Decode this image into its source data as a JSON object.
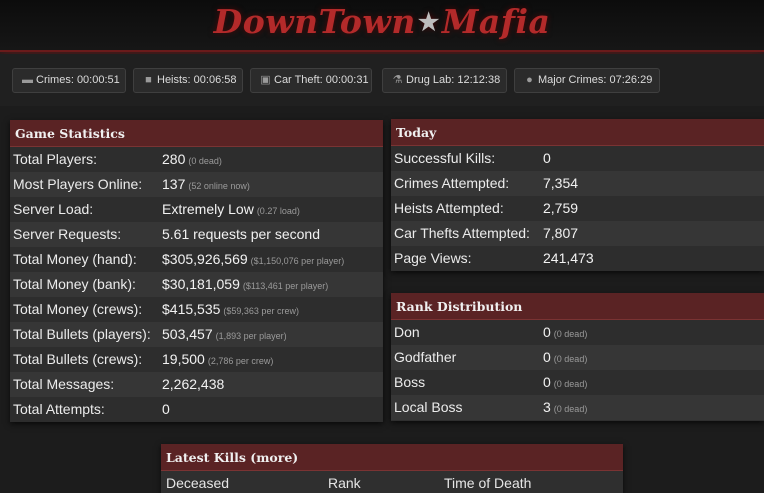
{
  "header": {
    "logo_left": "DownTown",
    "logo_star": "★",
    "logo_right": "Mafia"
  },
  "timers": [
    {
      "icon": "gun-icon",
      "label": "Crimes: 00:00:51"
    },
    {
      "icon": "truck-icon",
      "label": "Heists: 00:06:58"
    },
    {
      "icon": "car-icon",
      "label": "Car Theft: 00:00:31"
    },
    {
      "icon": "flask-icon",
      "label": "Drug Lab: 12:12:38"
    },
    {
      "icon": "group-icon",
      "label": "Major Crimes: 07:26:29"
    }
  ],
  "game_stats": {
    "title": "Game Statistics",
    "rows": [
      {
        "label": "Total Players:",
        "value": "280",
        "sub": "(0 dead)"
      },
      {
        "label": "Most Players Online:",
        "value": "137",
        "sub": "(52 online now)"
      },
      {
        "label": "Server Load:",
        "value": "Extremely Low",
        "sub": "(0.27 load)"
      },
      {
        "label": "Server Requests:",
        "value": "5.61 requests per second",
        "sub": ""
      },
      {
        "label": "Total Money (hand):",
        "value": "$305,926,569",
        "sub": "($1,150,076 per player)"
      },
      {
        "label": "Total Money (bank):",
        "value": "$30,181,059",
        "sub": "($113,461 per player)"
      },
      {
        "label": "Total Money (crews):",
        "value": "$415,535",
        "sub": "($59,363 per crew)"
      },
      {
        "label": "Total Bullets (players):",
        "value": "503,457",
        "sub": "(1,893 per player)"
      },
      {
        "label": "Total Bullets (crews):",
        "value": "19,500",
        "sub": "(2,786 per crew)"
      },
      {
        "label": "Total Messages:",
        "value": "2,262,438",
        "sub": ""
      },
      {
        "label": "Total Attempts:",
        "value": "0",
        "sub": ""
      }
    ]
  },
  "today": {
    "title": "Today",
    "rows": [
      {
        "label": "Successful Kills:",
        "value": "0"
      },
      {
        "label": "Crimes Attempted:",
        "value": "7,354"
      },
      {
        "label": "Heists Attempted:",
        "value": "2,759"
      },
      {
        "label": "Car Thefts Attempted:",
        "value": "7,807"
      },
      {
        "label": "Page Views:",
        "value": "241,473"
      }
    ]
  },
  "rank_distribution": {
    "title": "Rank Distribution",
    "rows": [
      {
        "label": "Don",
        "value": "0",
        "sub": "(0 dead)"
      },
      {
        "label": "Godfather",
        "value": "0",
        "sub": "(0 dead)"
      },
      {
        "label": "Boss",
        "value": "0",
        "sub": "(0 dead)"
      },
      {
        "label": "Local Boss",
        "value": "3",
        "sub": "(0 dead)"
      }
    ]
  },
  "latest_kills": {
    "title": "Latest Kills (more)",
    "columns": [
      "Deceased",
      "Rank",
      "Time of Death"
    ]
  }
}
